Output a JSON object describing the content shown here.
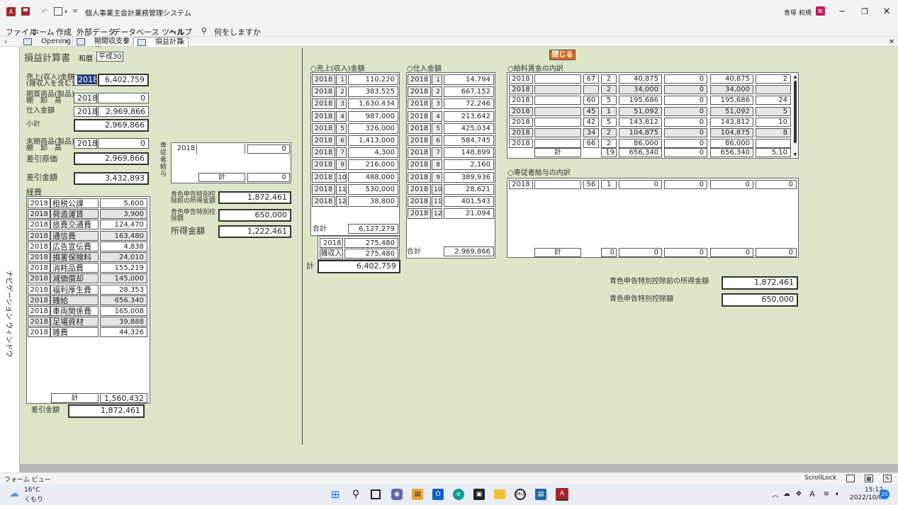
{
  "titlebar": {
    "title": "個人事業主会計業務管理システム",
    "user": "青塚 和規"
  },
  "ribbon": [
    "ファイル",
    "ホーム",
    "作成",
    "外部データ",
    "データベース ツール",
    "ヘルプ"
  ],
  "ribbon_search": "何をしますか",
  "tabs": [
    {
      "label": "Opening"
    },
    {
      "label": "期間収支参照"
    },
    {
      "label": "損益計算書"
    }
  ],
  "nav_label": "ナビゲーション ウィンドウ",
  "form": {
    "title": "損益計算書",
    "era_label": "和暦",
    "era_value": "平成30",
    "close_label": "閉じる",
    "left": {
      "sales_label1": "売上(収入)金額",
      "sales_label2": "(雑収入を含む)",
      "sales_year": "2018",
      "sales_value": "6,402,759",
      "open_label1": "期首商品(製品)",
      "open_label2": "棚　卸　高",
      "open_year": "2018",
      "open_value": "0",
      "purchase_label": "仕入金額",
      "purchase_year": "2018",
      "purchase_value": "2,969,866",
      "subtotal_label": "小計",
      "subtotal_value": "2,969,866",
      "close_label1": "末期商品(製品)",
      "close_label2": "棚　卸　高",
      "close_year": "2018",
      "close_value": "0",
      "cogs_label": "差引原価",
      "cogs_value": "2,969,866",
      "gross_label": "差引金額",
      "gross_value": "3,432,893",
      "expenses_label": "経費",
      "expenses": [
        {
          "year": "2018",
          "name": "租税公課",
          "amount": "5,600"
        },
        {
          "year": "2018",
          "name": "荷造運賃",
          "amount": "3,900"
        },
        {
          "year": "2018",
          "name": "旅費交通費",
          "amount": "124,470"
        },
        {
          "year": "2018",
          "name": "通信費",
          "amount": "163,480"
        },
        {
          "year": "2018",
          "name": "広告宣伝費",
          "amount": "4,838"
        },
        {
          "year": "2018",
          "name": "損害保険料",
          "amount": "24,010"
        },
        {
          "year": "2018",
          "name": "消耗品費",
          "amount": "155,219"
        },
        {
          "year": "2018",
          "name": "減価償却",
          "amount": "145,000"
        },
        {
          "year": "2018",
          "name": "福利厚生費",
          "amount": "28,353"
        },
        {
          "year": "2018",
          "name": "雑給",
          "amount": "656,340"
        },
        {
          "year": "2018",
          "name": "車両関係費",
          "amount": "165,008"
        },
        {
          "year": "2018",
          "name": "足場資材",
          "amount": "39,888"
        },
        {
          "year": "2018",
          "name": "雑費",
          "amount": "44,326"
        }
      ],
      "expenses_total_label": "計",
      "expenses_total": "1,560,432",
      "net_label": "差引金額",
      "net_value": "1,872,461"
    },
    "middle": {
      "emp_label": "専従者給与",
      "emp_year": "2018",
      "emp_value": "0",
      "emp_total_label": "計",
      "emp_total": "0",
      "pre_label1": "青色申告特別控",
      "pre_label2": "除前の所得金額",
      "pre_value": "1,872,461",
      "ded_label1": "青色申告特別控",
      "ded_label2": "除額",
      "ded_value": "650,000",
      "income_label": "所得金額",
      "income_value": "1,222,461"
    },
    "sales": {
      "header": "○売上(収入)金額",
      "rows": [
        {
          "year": "2018",
          "month": "1",
          "amount": "110,220"
        },
        {
          "year": "2018",
          "month": "2",
          "amount": "383,525"
        },
        {
          "year": "2018",
          "month": "3",
          "amount": "1,630,434"
        },
        {
          "year": "2018",
          "month": "4",
          "amount": "987,000"
        },
        {
          "year": "2018",
          "month": "5",
          "amount": "326,000"
        },
        {
          "year": "2018",
          "month": "6",
          "amount": "1,413,000"
        },
        {
          "year": "2018",
          "month": "7",
          "amount": "4,300"
        },
        {
          "year": "2018",
          "month": "9",
          "amount": "216,000"
        },
        {
          "year": "2018",
          "month": "10",
          "amount": "488,000"
        },
        {
          "year": "2018",
          "month": "11",
          "amount": "530,000"
        },
        {
          "year": "2018",
          "month": "12",
          "amount": "38,800"
        }
      ],
      "total_label": "合計",
      "total": "6,127,279",
      "misc_year": "2018",
      "misc_value": "275,480",
      "misc_label": "雑収入",
      "misc_value2": "275,480",
      "grand_label": "計",
      "grand_total": "6,402,759"
    },
    "purchases": {
      "header": "○仕入金額",
      "rows": [
        {
          "year": "2018",
          "month": "1",
          "amount": "14,794"
        },
        {
          "year": "2018",
          "month": "2",
          "amount": "667,152"
        },
        {
          "year": "2018",
          "month": "3",
          "amount": "72,246"
        },
        {
          "year": "2018",
          "month": "4",
          "amount": "213,642"
        },
        {
          "year": "2018",
          "month": "5",
          "amount": "425,034"
        },
        {
          "year": "2018",
          "month": "6",
          "amount": "584,745"
        },
        {
          "year": "2018",
          "month": "7",
          "amount": "148,899"
        },
        {
          "year": "2018",
          "month": "8",
          "amount": "2,160"
        },
        {
          "year": "2018",
          "month": "9",
          "amount": "389,936"
        },
        {
          "year": "2018",
          "month": "10",
          "amount": "28,621"
        },
        {
          "year": "2018",
          "month": "11",
          "amount": "401,543"
        },
        {
          "year": "2018",
          "month": "12",
          "amount": "21,094"
        }
      ],
      "total_label": "合計",
      "total": "2,969,866"
    },
    "wages": {
      "header": "○給料賃金の内訳",
      "rows": [
        {
          "year": "2018",
          "age": "67",
          "months": "2",
          "pay": "40,875",
          "bonus": "0",
          "total": "40,875",
          "tax": "2"
        },
        {
          "year": "2018",
          "age": "",
          "months": "2",
          "pay": "34,000",
          "bonus": "0",
          "total": "34,000",
          "tax": ""
        },
        {
          "year": "2018",
          "age": "60",
          "months": "5",
          "pay": "195,686",
          "bonus": "0",
          "total": "195,686",
          "tax": "24"
        },
        {
          "year": "2018",
          "age": "45",
          "months": "1",
          "pay": "51,092",
          "bonus": "0",
          "total": "51,092",
          "tax": "5"
        },
        {
          "year": "2018",
          "age": "42",
          "months": "5",
          "pay": "143,812",
          "bonus": "0",
          "total": "143,812",
          "tax": "10"
        },
        {
          "year": "2018",
          "age": "34",
          "months": "2",
          "pay": "104,875",
          "bonus": "0",
          "total": "104,875",
          "tax": "8"
        },
        {
          "year": "2018",
          "age": "66",
          "months": "2",
          "pay": "86,000",
          "bonus": "0",
          "total": "86,000",
          "tax": ""
        }
      ],
      "total_label": "計",
      "total_months": "19",
      "total_pay": "656,340",
      "total_bonus": "0",
      "total_total": "656,340",
      "total_tax": "5,10"
    },
    "emp_wages": {
      "header": "○専従者給与の内訳",
      "row": {
        "year": "2018",
        "age": "56",
        "months": "1",
        "pay": "0",
        "bonus": "0",
        "total": "0",
        "tax": "0"
      },
      "total_label": "計",
      "totals": [
        "0",
        "0",
        "0",
        "0",
        "0"
      ]
    },
    "summary": {
      "pre_label": "青色申告特別控除前の所得金額",
      "pre_value": "1,872,461",
      "ded_label": "青色申告特別控除額",
      "ded_value": "650,000"
    }
  },
  "statusbar": {
    "left": "フォーム ビュー",
    "right": "ScrollLock"
  },
  "taskbar": {
    "temp": "16°C",
    "weather": "くもり",
    "time": "15:12",
    "date": "2022/10/05",
    "notif": "20",
    "lang": "A"
  }
}
